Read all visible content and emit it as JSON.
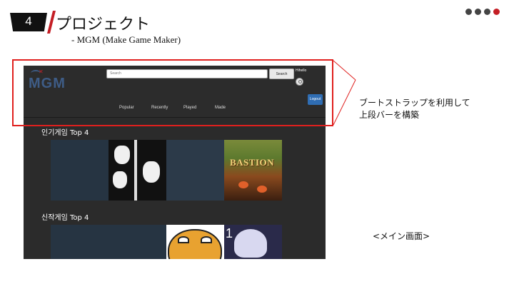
{
  "slide": {
    "number": "4",
    "title": "プロジェクト",
    "subtitle": "- MGM (Make Game Maker)"
  },
  "annotations": {
    "note_line1": "ブートストラップを利用して",
    "note_line2": "上段バーを構築",
    "caption": "<メイン画面>",
    "highlight_color": "#e0201e"
  },
  "app": {
    "logo": "MGM",
    "search": {
      "placeholder": "Search",
      "button_label": "Search"
    },
    "user": {
      "name": "Hihello"
    },
    "logout_label": "Logout",
    "nav": [
      "Popular",
      "Recently",
      "Played",
      "Made"
    ],
    "sections": [
      {
        "title": "인기게임 Top 4"
      },
      {
        "title": "신작게임 Top 4"
      }
    ],
    "colors": {
      "background": "#2b2b2b",
      "logo": "#3e5c86",
      "logout_button": "#2f6db3",
      "accent_red": "#c41e25"
    }
  }
}
